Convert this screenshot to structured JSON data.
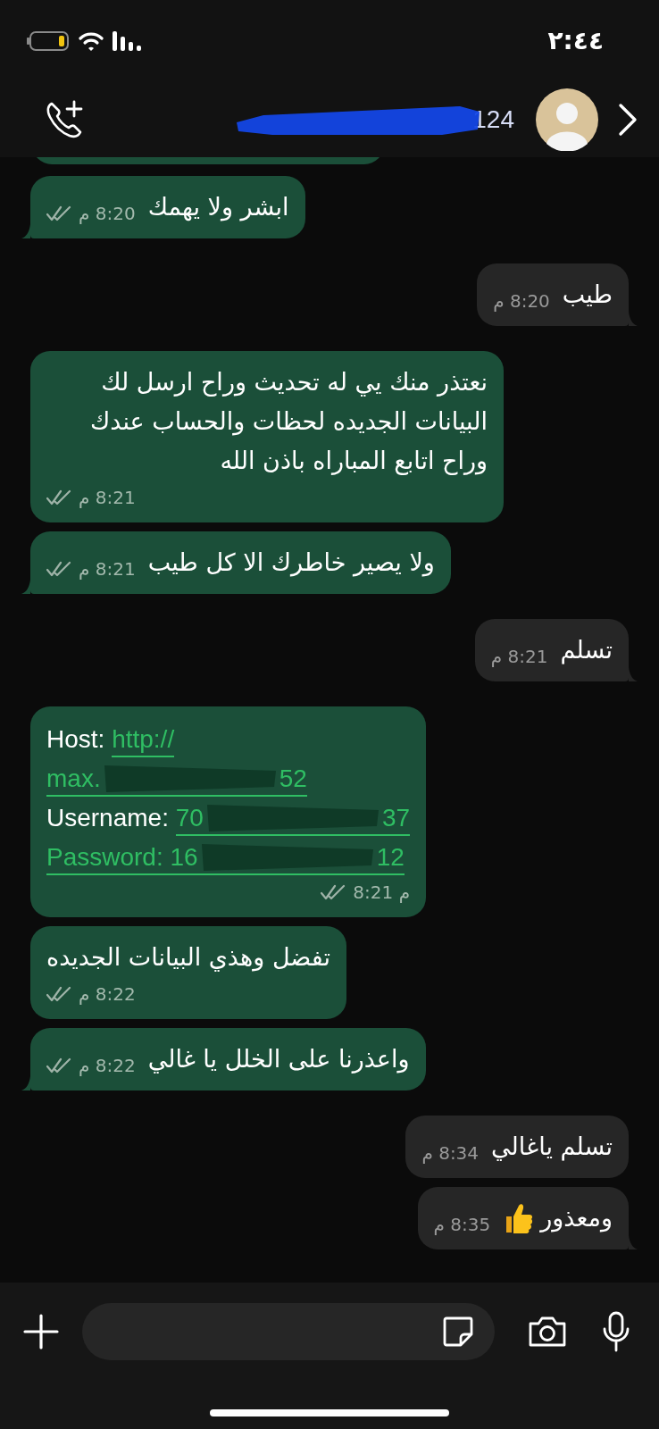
{
  "status_bar": {
    "time": "٢:٤٤"
  },
  "header": {
    "title": "124"
  },
  "messages": [
    {
      "outgoing": true,
      "text": "ابشر ولا يهمك",
      "time": "8:20 م",
      "read": false,
      "time_below": false
    },
    {
      "outgoing": false,
      "text": "طيب",
      "time": "8:20 م",
      "time_below": false
    },
    {
      "outgoing": true,
      "text": "نعتذر منك يي له تحديث وراح ارسل لك البيانات الجديده لحظات والحساب عندك وراح اتابع المباراه باذن الله",
      "time": "8:21 م",
      "read": false,
      "time_below": true
    },
    {
      "outgoing": true,
      "text": "ولا يصير خاطرك الا كل طيب",
      "time": "8:21 م",
      "read": false,
      "time_below": false
    },
    {
      "outgoing": false,
      "text": "تسلم",
      "time": "8:21 م",
      "time_below": false
    },
    {
      "outgoing": true,
      "kind": "credentials",
      "lines": [
        {
          "prefix": "Host: ",
          "link_start": "http://"
        },
        {
          "link_start": "max.",
          "link_end": "52"
        },
        {
          "prefix": "Username: ",
          "link_start": "70",
          "link_end": "37"
        },
        {
          "link_start": "Password: 16",
          "link_end": "12"
        }
      ],
      "time": "8:21 م",
      "read": false,
      "time_below": true
    },
    {
      "outgoing": true,
      "text": "تفضل وهذي البيانات الجديده",
      "time": "8:22 م",
      "read": false,
      "time_below": true
    },
    {
      "outgoing": true,
      "text": "واعذرنا على الخلل يا غالي",
      "time": "8:22 م",
      "read": false,
      "time_below": false
    },
    {
      "outgoing": false,
      "text": "تسلم ياغالي",
      "time": "8:34 م",
      "time_below": false
    },
    {
      "outgoing": false,
      "kind": "emoji",
      "text": "ومعذور",
      "time": "8:35 م",
      "time_below": false
    }
  ]
}
